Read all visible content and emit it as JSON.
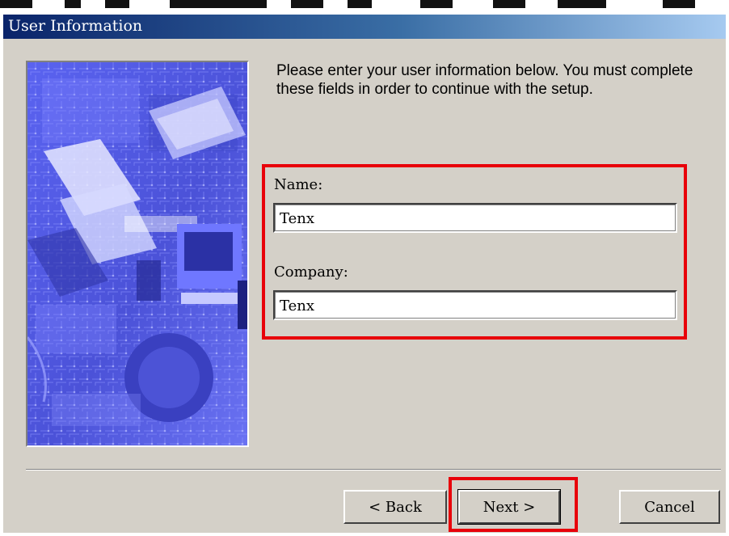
{
  "window": {
    "title": "User Information"
  },
  "instructions": "Please enter your user information below.  You must complete these fields in order to continue with the setup.",
  "form": {
    "name_label": "Name:",
    "name_value": "Tenx",
    "company_label": "Company:",
    "company_value": "Tenx"
  },
  "buttons": {
    "back": "< Back",
    "next": "Next >",
    "cancel": "Cancel"
  },
  "colors": {
    "dialog_bg": "#d4d0c8",
    "titlebar_start": "#0a246a",
    "titlebar_end": "#a6caf0",
    "highlight": "#e8000a",
    "art_primary": "#5a63f0"
  },
  "icons": {
    "art": "setup-wizard-computer-artwork"
  }
}
